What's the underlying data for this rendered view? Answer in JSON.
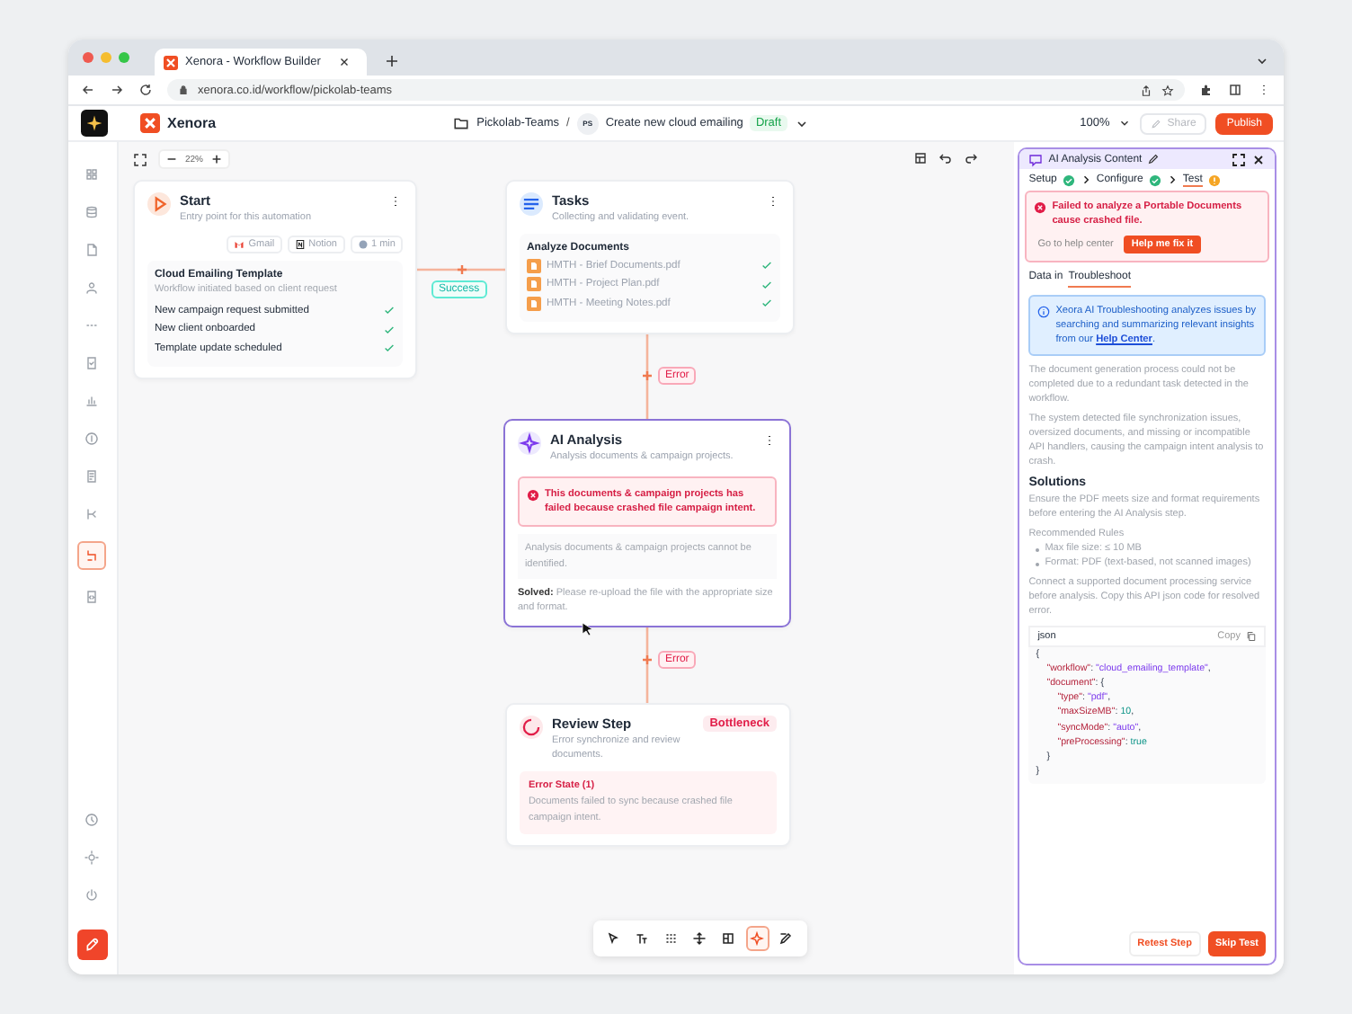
{
  "browser": {
    "tab_title": "Xenora - Workflow Builder",
    "url": "xenora.co.id/workflow/pickolab-teams"
  },
  "header": {
    "app_name": "Xenora",
    "folder": "Pickolab-Teams",
    "separator": "/",
    "avatar": "PS",
    "doc_title": "Create new cloud emailing",
    "status": "Draft",
    "zoom": "100%",
    "share": {
      "label": "Share",
      "disabled": true
    },
    "publish": "Publish"
  },
  "sidebar": {
    "items": [
      {
        "selected": false
      },
      {
        "selected": false
      },
      {
        "selected": false
      },
      {
        "selected": false
      },
      {
        "selected": false
      },
      {
        "selected": false
      },
      {
        "selected": false
      },
      {
        "selected": false
      },
      {
        "selected": false
      },
      {
        "selected": false
      },
      {
        "selected": true
      },
      {
        "selected": false
      },
      {
        "selected": false
      },
      {
        "selected": false
      },
      {
        "selected": false
      }
    ]
  },
  "canvas": {
    "zoom": "22%",
    "nodes": [
      {
        "kind": "start",
        "title": "Start",
        "subtitle": "Entry point for this automation",
        "selected": false,
        "chips": [
          "Gmail",
          "Notion",
          "1 min"
        ],
        "template": {
          "title": "Cloud Emailing Template",
          "subtitle": "Workflow initiated based on client request",
          "items": [
            {
              "label": "New campaign request submitted",
              "done": true
            },
            {
              "label": "New client onboarded",
              "done": true
            },
            {
              "label": "Template update scheduled",
              "done": true
            }
          ]
        }
      },
      {
        "kind": "tasks",
        "title": "Tasks",
        "subtitle": "Collecting and validating event.",
        "selected": false,
        "section": "Analyze Documents",
        "files": [
          {
            "name": "HMTH - Brief Documents.pdf",
            "done": true
          },
          {
            "name": "HMTH - Project Plan.pdf",
            "done": true
          },
          {
            "name": "HMTH - Meeting Notes.pdf",
            "done": true
          }
        ]
      },
      {
        "kind": "ai",
        "title": "AI Analysis",
        "subtitle": "Analysis documents & campaign projects.",
        "selected": true,
        "error": "This documents & campaign projects has failed because crashed file campaign intent.",
        "note": "Analysis documents & campaign projects cannot be identified.",
        "solved_label": "Solved:",
        "solved": "Please re-upload the file with the appropriate size and format."
      },
      {
        "kind": "review",
        "title": "Review Step",
        "subtitle": "Error synchronize and review documents.",
        "selected": false,
        "badge": "Bottleneck",
        "error_title": "Error State (1)",
        "error_text": "Documents failed to sync because crashed file campaign intent."
      }
    ],
    "connectors": [
      {
        "kind": "success",
        "label": "Success"
      },
      {
        "kind": "error",
        "label": "Error"
      },
      {
        "kind": "error",
        "label": "Error"
      }
    ],
    "toolbar": {
      "tools": [
        {
          "selected": false
        },
        {
          "selected": false
        },
        {
          "selected": false
        },
        {
          "selected": false
        },
        {
          "selected": false
        },
        {
          "selected": true
        },
        {
          "selected": false
        }
      ]
    }
  },
  "panel": {
    "title": "AI Analysis Content",
    "steps": [
      {
        "label": "Setup",
        "done": true,
        "selected": false
      },
      {
        "label": "Configure",
        "done": true,
        "selected": false
      },
      {
        "label": "Test",
        "done": false,
        "selected": true
      }
    ],
    "alert": {
      "text": "Failed to analyze a Portable Documents cause crashed file.",
      "secondary": "Go to help center",
      "primary": "Help me fix it"
    },
    "tabs": [
      {
        "label": "Data in",
        "selected": false
      },
      {
        "label": "Troubleshoot",
        "selected": true
      }
    ],
    "info": {
      "text": "Xeora AI Troubleshooting analyzes issues by searching and summarizing relevant insights from our ",
      "link": "Help Center",
      "end": "."
    },
    "paragraphs": [
      "The document generation process could not be completed due to a redundant task detected in the workflow.",
      "The system detected file synchronization issues, oversized documents, and missing or incompatible API handlers, causing the campaign intent analysis to crash."
    ],
    "solutions_title": "Solutions",
    "solution_text": "Ensure the PDF meets size and format requirements before entering the AI Analysis step.",
    "rules_title": "Recommended Rules",
    "rules": [
      "Max file size: ≤ 10 MB",
      "Format: PDF (text-based, not scanned images)"
    ],
    "connect_text": "Connect a supported document processing service before analysis. Copy this API json code for resolved error.",
    "code": {
      "language": "json",
      "copy": "Copy",
      "lines": [
        {
          "text": "{",
          "children": [
            {
              "text": "\"workflow\": \"cloud_emailing_template\","
            },
            {
              "text": "\"document\": {",
              "children": [
                {
                  "text": "\"type\": \"pdf\","
                },
                {
                  "text": "\"maxSizeMB\": 10,"
                },
                {
                  "text": "\"syncMode\": \"auto\","
                },
                {
                  "text": "\"preProcessing\": true"
                }
              ]
            },
            {
              "text": "}"
            }
          ]
        },
        {
          "text": "}"
        }
      ]
    },
    "buttons": {
      "secondary": "Retest Step",
      "primary": "Skip Test"
    }
  }
}
